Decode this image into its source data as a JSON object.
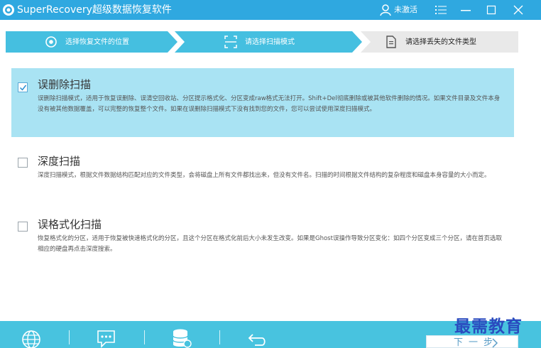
{
  "window": {
    "title": "SuperRecovery超级数据恢复软件",
    "activation_status": "未激活"
  },
  "steps": [
    {
      "label": "选择恢复文件的位置",
      "state": "done"
    },
    {
      "label": "请选择扫描模式",
      "state": "done"
    },
    {
      "label": "请选择丢失的文件类型",
      "state": "current"
    }
  ],
  "options": [
    {
      "title": "误删除扫描",
      "checked": true,
      "description": "误删除扫描模式，适用于恢复误删除、误清空回收站、分区提示格式化、分区变成raw格式无法打开。Shift+Del彻底删除或被其他软件删除的情况。如果文件目录及文件本身没有被其他数据覆盖，可以完整的恢复整个文件。如果在误删除扫描模式下没有找到您的文件，您可以尝试使用深度扫描模式。"
    },
    {
      "title": "深度扫描",
      "checked": false,
      "description": "深度扫描模式，根据文件数据结构匹配对应的文件类型，会将磁盘上所有文件都找出来，但没有文件名。扫描的时间根据文件结构的复杂程度和磁盘本身容量的大小而定。"
    },
    {
      "title": "误格式化扫描",
      "checked": false,
      "description": "恢复格式化的分区，适用于恢复被快速格式化的分区，且这个分区在格式化前后大小未发生改变。如果是Ghost误操作导致分区变化：如四个分区变成三个分区，请在首页选取相应的硬盘再点击深度搜索。"
    }
  ],
  "bottom": {
    "next_label": "下一步",
    "watermark": "最需教育"
  },
  "colors": {
    "titlebar": "#2fa8e0",
    "step_done": "#45bfe0",
    "step_current": "#e9e9e9",
    "selected_option": "#a9e3f3",
    "bottombar": "#48c3df",
    "watermark": "#2a4bbf"
  },
  "icons": {
    "app": "app-logo-icon",
    "user": "user-icon",
    "menu": "menu-icon",
    "minimize": "minimize-icon",
    "maximize": "maximize-icon",
    "close": "close-icon",
    "step_location": "target-icon",
    "step_scan": "scan-frame-icon",
    "step_filetype": "document-icon",
    "website": "globe-icon",
    "support": "chat-icon",
    "database": "database-icon",
    "back": "back-arrow-icon"
  }
}
